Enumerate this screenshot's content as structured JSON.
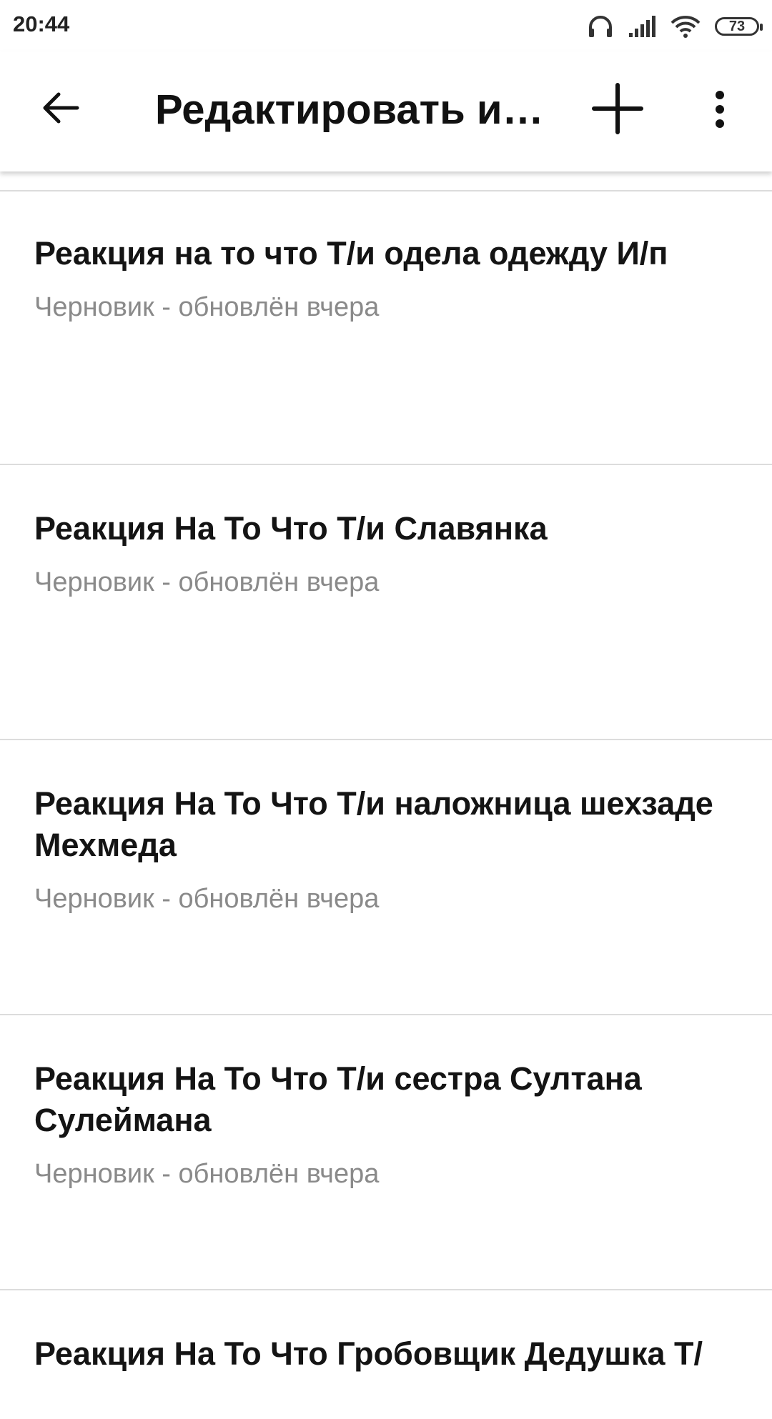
{
  "status_bar": {
    "time": "20:44",
    "battery": "73",
    "icons": [
      "headphones-icon",
      "signal-icon",
      "wifi-icon",
      "battery-icon"
    ]
  },
  "app_bar": {
    "title": "Редактировать и…",
    "back_icon": "arrow-left-icon",
    "add_icon": "plus-icon",
    "more_icon": "more-vertical-icon"
  },
  "list": {
    "items": [
      {
        "title": "Реакция на то что Т/и одела одежду И/п",
        "subtitle": "Черновик - обновлён вчера"
      },
      {
        "title": "Реакция На То Что Т/и Славянка",
        "subtitle": "Черновик - обновлён вчера"
      },
      {
        "title": "Реакция На То Что Т/и наложница шехзаде Мехмеда",
        "subtitle": "Черновик - обновлён вчера"
      },
      {
        "title": "Реакция На То Что Т/и сестра Султана Сулеймана",
        "subtitle": "Черновик - обновлён вчера"
      },
      {
        "title": "Реакция На То Что Гробовщик Дедушка Т/",
        "subtitle": ""
      }
    ]
  },
  "colors": {
    "background": "#ffffff",
    "title_text": "#141414",
    "subtitle_text": "#8a8a8a",
    "divider": "#dcdcdc"
  }
}
